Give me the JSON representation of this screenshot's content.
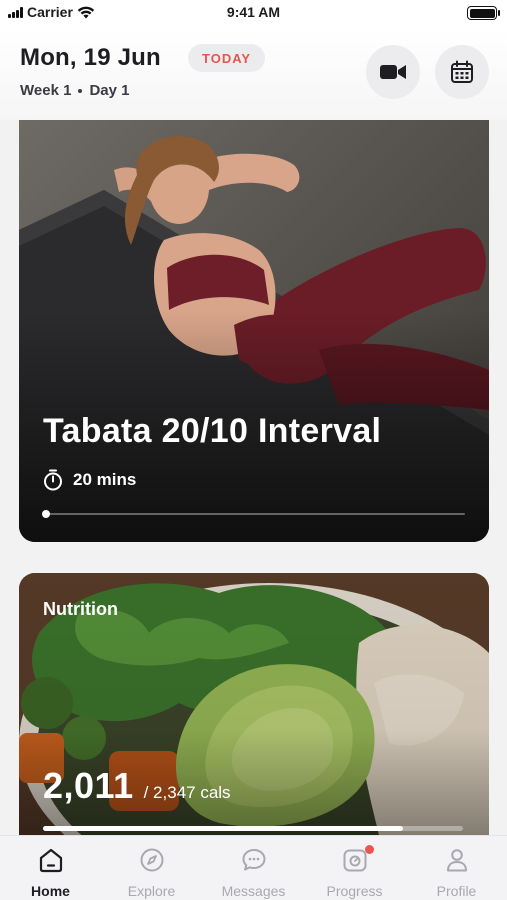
{
  "status_bar": {
    "carrier": "Carrier",
    "time": "9:41 AM"
  },
  "header": {
    "date": "Mon, 19 Jun",
    "today_badge": "TODAY",
    "week": "Week 1",
    "day": "Day 1",
    "icons": [
      "video-camera-icon",
      "calendar-icon"
    ]
  },
  "workout_card": {
    "title": "Tabata 20/10 Interval",
    "duration": "20 mins",
    "progress_fraction": 0.0
  },
  "nutrition_card": {
    "label": "Nutrition",
    "calories_consumed": "2,011",
    "calories_goal": "/ 2,347 cals",
    "progress_fraction": 0.857
  },
  "tab_bar": {
    "items": [
      {
        "label": "Home",
        "icon": "home-icon",
        "active": true
      },
      {
        "label": "Explore",
        "icon": "compass-icon",
        "active": false
      },
      {
        "label": "Messages",
        "icon": "chat-bubble-icon",
        "active": false
      },
      {
        "label": "Progress",
        "icon": "progress-icon",
        "active": false,
        "notification": true
      },
      {
        "label": "Profile",
        "icon": "person-icon",
        "active": false
      }
    ]
  },
  "colors": {
    "accent": "#e2574c",
    "badge": "#ef5350",
    "text": "#1d1d22",
    "muted": "#a8a8b0"
  }
}
